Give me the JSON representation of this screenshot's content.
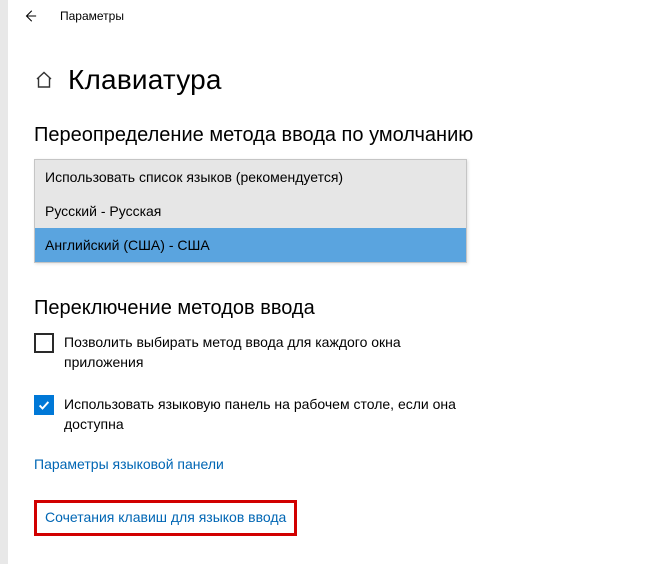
{
  "titlebar": {
    "app_name": "Параметры"
  },
  "page": {
    "title": "Клавиатура"
  },
  "section1": {
    "title": "Переопределение метода ввода по умолчанию",
    "options": [
      "Использовать список языков (рекомендуется)",
      "Русский - Русская",
      "Английский (США) - США"
    ]
  },
  "section2": {
    "title": "Переключение методов ввода",
    "checkbox1_label": "Позволить выбирать метод ввода для каждого окна приложения",
    "checkbox2_label": "Использовать языковую панель на рабочем столе, если она доступна",
    "link1": "Параметры языковой панели",
    "link2": "Сочетания клавиш для языков ввода"
  }
}
